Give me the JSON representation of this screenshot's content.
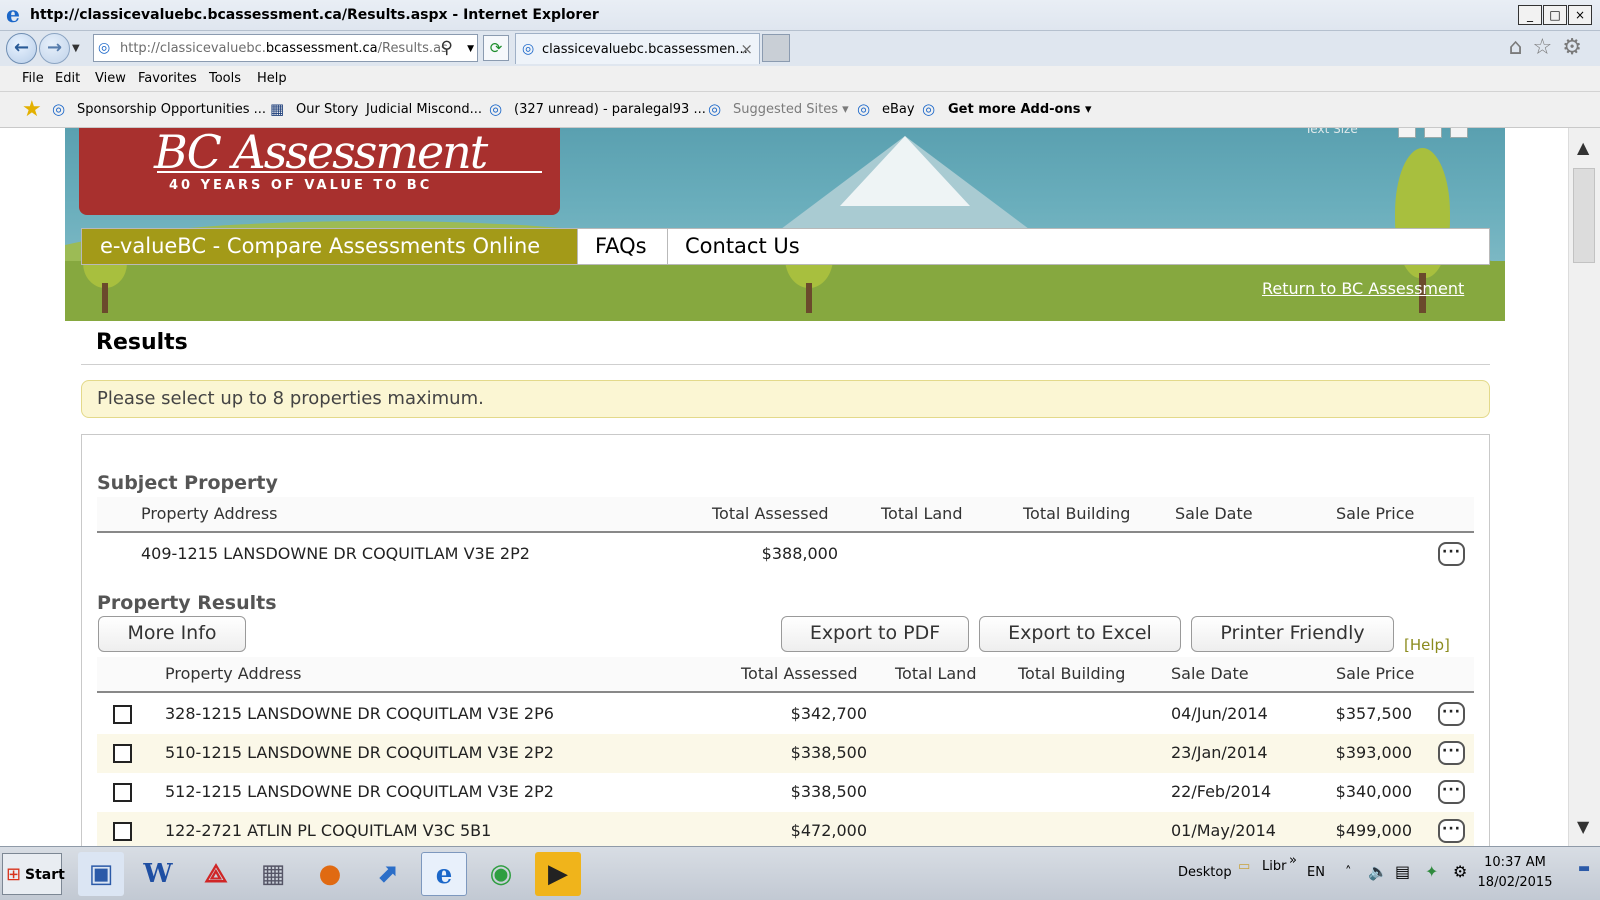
{
  "browser": {
    "title": "http://classicevaluebc.bcassessment.ca/Results.aspx - Internet Explorer",
    "address": {
      "prefix": "http://classicevaluebc.",
      "domain": "bcassessment.ca",
      "suffix": "/Results.as"
    },
    "tab_label": "classicevaluebc.bcassessmen...",
    "window_buttons": [
      "_",
      "□",
      "×"
    ],
    "menu": [
      "File",
      "Edit",
      "View",
      "Favorites",
      "Tools",
      "Help"
    ],
    "favorites": [
      "Sponsorship Opportunities ...",
      "Our Story",
      "Judicial Miscond...",
      "(327 unread) - paralegal93 ...",
      "Suggested Sites ▾",
      "eBay",
      "Get more Add-ons ▾"
    ]
  },
  "site": {
    "logo_name": "BC Assessment",
    "logo_tagline": "40 YEARS OF VALUE TO BC",
    "text_size_label": "Text Size",
    "nav": [
      "e-valueBC - Compare Assessments Online",
      "FAQs",
      "Contact Us"
    ],
    "return_link": "Return to BC Assessment"
  },
  "results": {
    "title": "Results",
    "notice": "Please select up to 8 properties maximum.",
    "subject_title": "Subject Property",
    "columns": [
      "Property Address",
      "Total Assessed",
      "Total Land",
      "Total Building",
      "Sale Date",
      "Sale Price"
    ],
    "subject": {
      "address": "409-1215 LANSDOWNE DR COQUITLAM V3E 2P2",
      "total_assessed": "$388,000",
      "total_land": "",
      "total_building": "",
      "sale_date": "",
      "sale_price": ""
    },
    "property_results_title": "Property Results",
    "buttons": {
      "more_info": "More Info",
      "export_pdf": "Export to PDF",
      "export_excel": "Export to Excel",
      "printer_friendly": "Printer Friendly",
      "help": "[Help]"
    },
    "more_button": "···",
    "rows": [
      {
        "address": "328-1215 LANSDOWNE DR COQUITLAM V3E 2P6",
        "total_assessed": "$342,700",
        "sale_date": "04/Jun/2014",
        "sale_price": "$357,500"
      },
      {
        "address": "510-1215 LANSDOWNE DR COQUITLAM V3E 2P2",
        "total_assessed": "$338,500",
        "sale_date": "23/Jan/2014",
        "sale_price": "$393,000"
      },
      {
        "address": "512-1215 LANSDOWNE DR COQUITLAM V3E 2P2",
        "total_assessed": "$338,500",
        "sale_date": "22/Feb/2014",
        "sale_price": "$340,000"
      },
      {
        "address": "122-2721 ATLIN PL COQUITLAM V3C 5B1",
        "total_assessed": "$472,000",
        "sale_date": "01/May/2014",
        "sale_price": "$499,000"
      }
    ]
  },
  "taskbar": {
    "start": "Start",
    "desktop": "Desktop",
    "libraries": "Libr",
    "chevron": "»",
    "language": "EN",
    "time": "10:37 AM",
    "date": "18/02/2015",
    "icons": [
      "windows-explorer-icon",
      "word-icon",
      "acrobat-icon",
      "calculator-icon",
      "firefox-icon",
      "app-icon",
      "internet-explorer-icon",
      "chrome-icon",
      "media-player-icon"
    ]
  }
}
